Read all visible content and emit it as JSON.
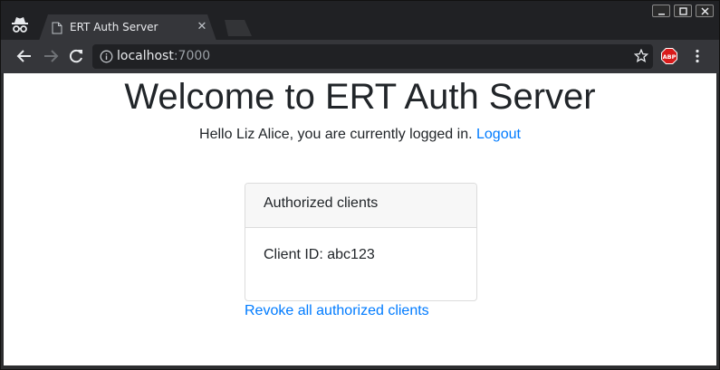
{
  "browser": {
    "tab_title": "ERT Auth Server",
    "tab_close": "✕",
    "url_host": "localhost",
    "url_port": ":7000",
    "extension_badge": "ABP",
    "icons": {
      "incognito": "incognito-icon",
      "page": "page-icon",
      "back": "back-arrow-icon",
      "forward": "forward-arrow-icon",
      "reload": "reload-icon",
      "info": "info-icon",
      "star": "star-icon",
      "menu": "more-vert-icon",
      "minimize": "minimize-icon",
      "maximize": "maximize-icon",
      "close": "close-icon"
    }
  },
  "page": {
    "heading": "Welcome to ERT Auth Server",
    "greeting_text": "Hello Liz Alice, you are currently logged in.",
    "logout_label": "Logout",
    "card": {
      "header": "Authorized clients",
      "client_line": "Client ID: abc123"
    },
    "revoke_label": "Revoke all authorized clients",
    "colors": {
      "link": "#007bff",
      "text": "#212529",
      "card_header_bg": "#f7f7f7"
    }
  }
}
